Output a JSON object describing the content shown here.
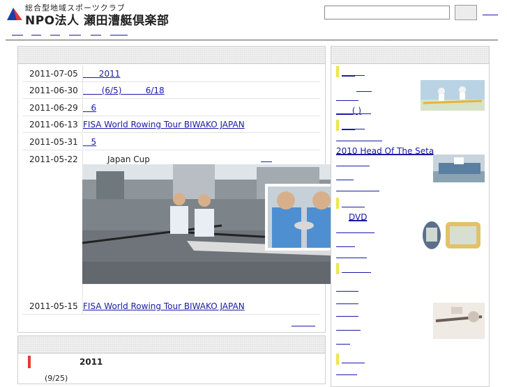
{
  "header": {
    "tagline": "総合型地域スポーツクラブ",
    "org_name": "NPO法人 瀬田漕艇倶楽部",
    "search_placeholder": "",
    "search_button_label": ""
  },
  "news": {
    "items": [
      {
        "date": "2011-07-05",
        "title": "      2011"
      },
      {
        "date": "2011-06-30",
        "title": "       (6/5)         6/18"
      },
      {
        "date": "2011-06-29",
        "title": "   6"
      },
      {
        "date": "2011-06-13",
        "title": "FISA World Rowing Tour BIWAKO JAPAN"
      },
      {
        "date": "2011-05-31",
        "title": "   5"
      }
    ],
    "feature": {
      "date": "2011-05-22",
      "title": "Japan Cup"
    },
    "last": {
      "date": "2011-05-15",
      "title": "FISA World Rowing Tour BIWAKO JAPAN"
    }
  },
  "event": {
    "year": "2011",
    "date": "(9/25)",
    "bar_color": "#e53935"
  },
  "sidebar": {
    "mark_color": "#ede64a",
    "items": [
      {
        "label": "     ",
        "marked": true
      },
      {
        "label": "     ",
        "marked": false
      },
      {
        "label": "      ( )",
        "marked": false
      },
      {
        "label": "     ",
        "marked": true
      },
      {
        "label": "2010 Head Of The Seta",
        "marked": false
      },
      {
        "label": "DVD",
        "marked": false
      }
    ]
  },
  "icons": {
    "logo": "club-logo-icon"
  }
}
